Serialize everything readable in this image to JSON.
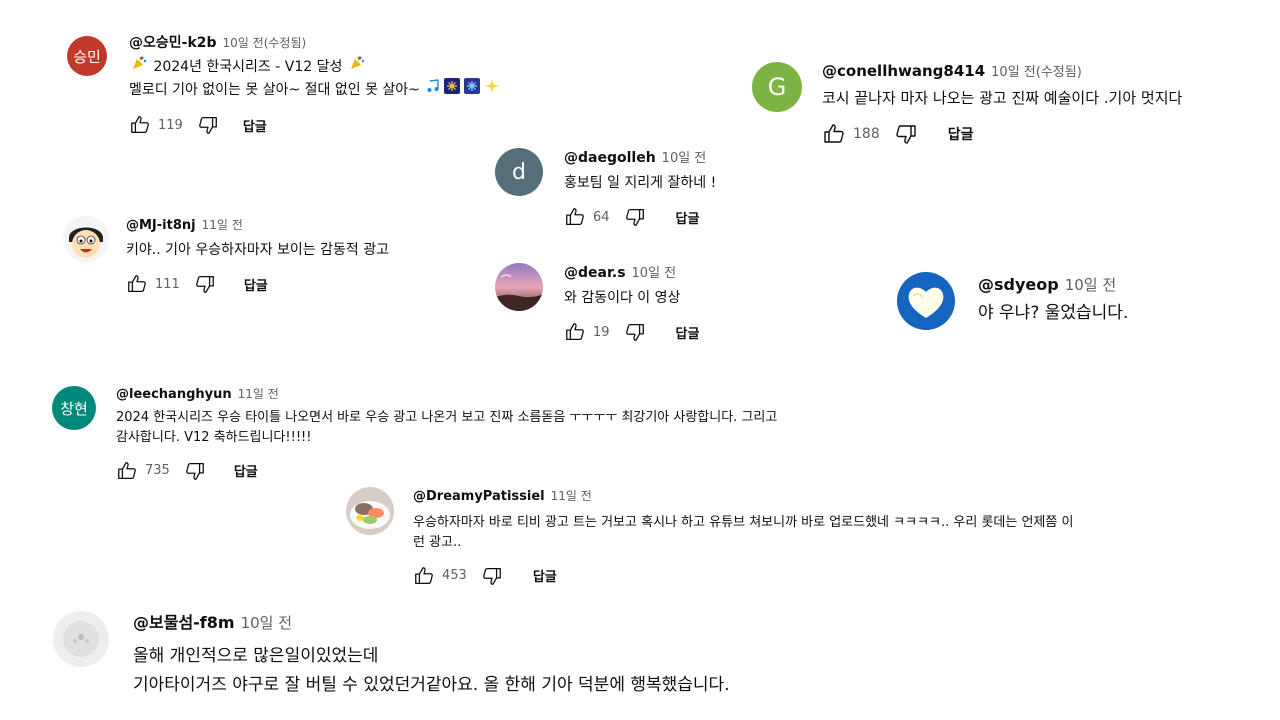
{
  "comments": [
    {
      "handle": "@오승민-k2b",
      "time": "10일 전(수정됨)",
      "avatar_text": "승민",
      "avatar_color": "#c0392b",
      "lines": [
        "2024년 한국시리즈 - V12 달성",
        "멜로디 기아 없이는 못 살아~ 절대 없인 못 살아~"
      ],
      "likes": "119",
      "reply": "답글"
    },
    {
      "handle": "@conellhwang8414",
      "time": "10일 전(수정됨)",
      "avatar_text": "G",
      "avatar_color": "#7cb342",
      "lines": [
        "코시 끝나자 마자 나오는 광고 진짜 예술이다 .기아 멋지다"
      ],
      "likes": "188",
      "reply": "답글"
    },
    {
      "handle": "@daegolleh",
      "time": "10일 전",
      "avatar_text": "d",
      "avatar_color": "#546e7a",
      "lines": [
        "홍보팀 일 지리게 잘하네 !"
      ],
      "likes": "64",
      "reply": "답글"
    },
    {
      "handle": "@MJ-it8nj",
      "time": "11일 전",
      "avatar_icon": "cartoon-face-avatar",
      "lines": [
        "키야.. 기아 우승하자마자 보이는 감동적 광고"
      ],
      "likes": "111",
      "reply": "답글"
    },
    {
      "handle": "@dear.s",
      "time": "10일 전",
      "avatar_icon": "sunset-photo-avatar",
      "lines": [
        "와 감동이다 이 영상"
      ],
      "likes": "19",
      "reply": "답글"
    },
    {
      "handle": "@sdyeop",
      "time": "10일 전",
      "avatar_icon": "heart-cloud-avatar",
      "lines": [
        "야 우냐? 울었습니다."
      ],
      "likes": "",
      "reply": ""
    },
    {
      "handle": "@leechanghyun",
      "time": "11일 전",
      "avatar_text": "창현",
      "avatar_color": "#00897b",
      "lines": [
        "2024 한국시리즈 우승 타이틀 나오면서 바로 우승 광고 나온거 보고 진짜 소름돋음 ㅜㅜㅜㅜ 최강기아 사랑합니다. 그리고",
        "감사합니다. V12 축하드립니다!!!!!"
      ],
      "likes": "735",
      "reply": "답글"
    },
    {
      "handle": "@DreamyPatissiel",
      "time": "11일 전",
      "avatar_icon": "food-photo-avatar",
      "lines": [
        "우승하자마자 바로 티비 광고 트는 거보고 혹시나 하고 유튜브 쳐보니까 바로 업로드했네 ㅋㅋㅋㅋ.. 우리 롯데는 언제쯤 이",
        "런 광고.."
      ],
      "likes": "453",
      "reply": "답글"
    },
    {
      "handle": "@보물섬-f8m",
      "time": "10일 전",
      "avatar_icon": "grey-cat-avatar",
      "lines": [
        "올해 개인적으로 많은일이있었는데",
        "기아타이거즈 야구로 잘 버틸 수 있었던거같아요. 올 한해 기아 덕분에 행복했습니다."
      ],
      "likes": "",
      "reply": ""
    }
  ]
}
